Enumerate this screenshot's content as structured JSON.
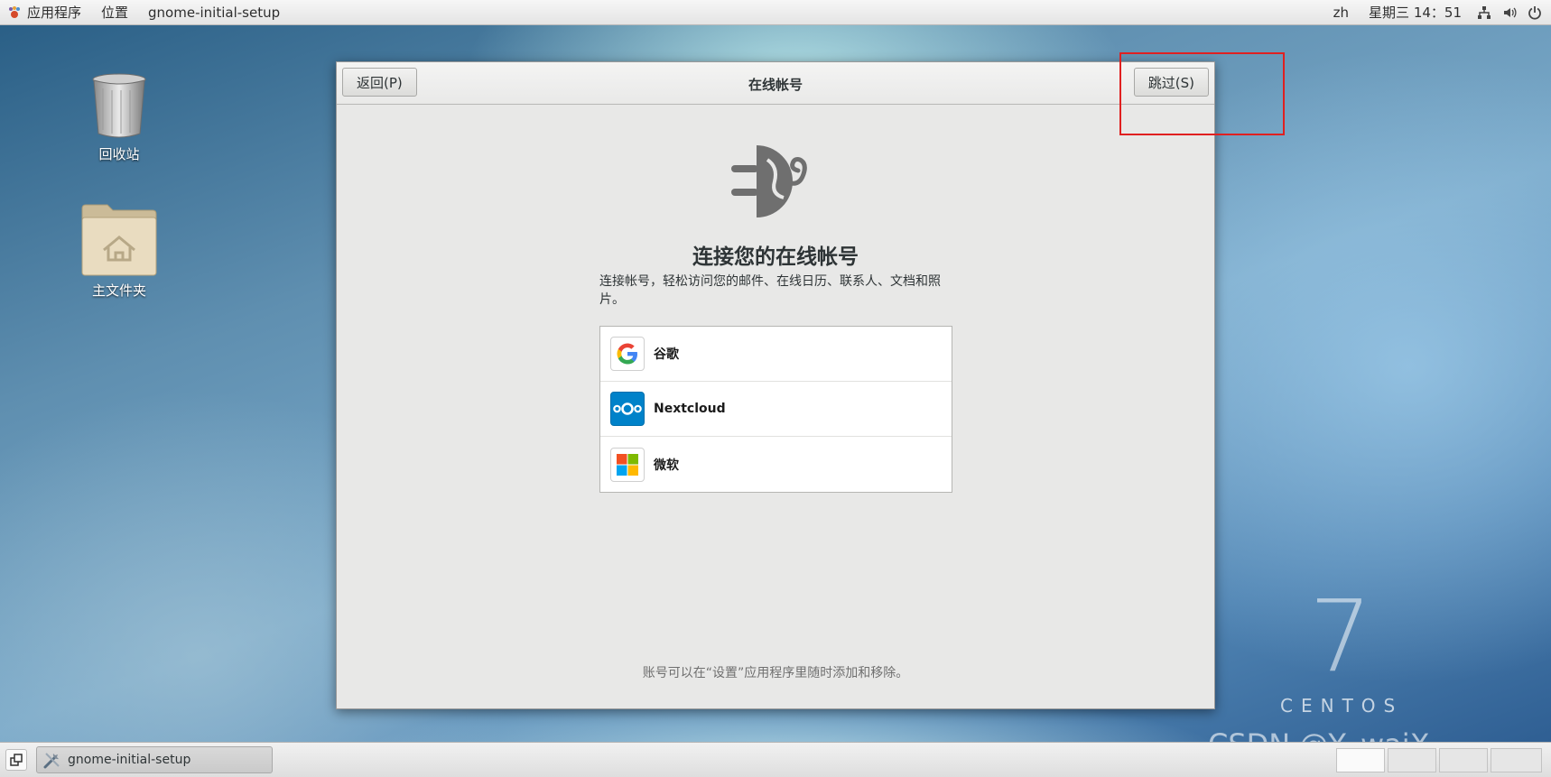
{
  "top_panel": {
    "apps_menu": "应用程序",
    "places_menu": "位置",
    "active_app": "gnome-initial-setup",
    "language": "zh",
    "clock": "星期三 14：51"
  },
  "desktop": {
    "icons": [
      {
        "label": "回收站",
        "icon": "trash-icon"
      },
      {
        "label": "主文件夹",
        "icon": "home-folder-icon"
      }
    ]
  },
  "window": {
    "title": "在线帐号",
    "back_label": "返回(P)",
    "skip_label": "跳过(S)",
    "heading": "连接您的在线帐号",
    "description": "连接帐号，轻松访问您的邮件、在线日历、联系人、文档和照片。",
    "providers": [
      {
        "name": "谷歌",
        "icon": "google-icon"
      },
      {
        "name": "Nextcloud",
        "icon": "nextcloud-icon"
      },
      {
        "name": "微软",
        "icon": "microsoft-icon"
      }
    ],
    "footer": "账号可以在“设置”应用程序里随时添加和移除。"
  },
  "branding": {
    "version_numeral": "7",
    "wordmark": "CENTOS",
    "watermark": "CSDN @Y_waiX"
  },
  "taskbar": {
    "task_label": "gnome-initial-setup"
  },
  "colors": {
    "highlight": "#e02020",
    "google_blue": "#4285f4",
    "nextcloud_blue": "#0082c9"
  }
}
